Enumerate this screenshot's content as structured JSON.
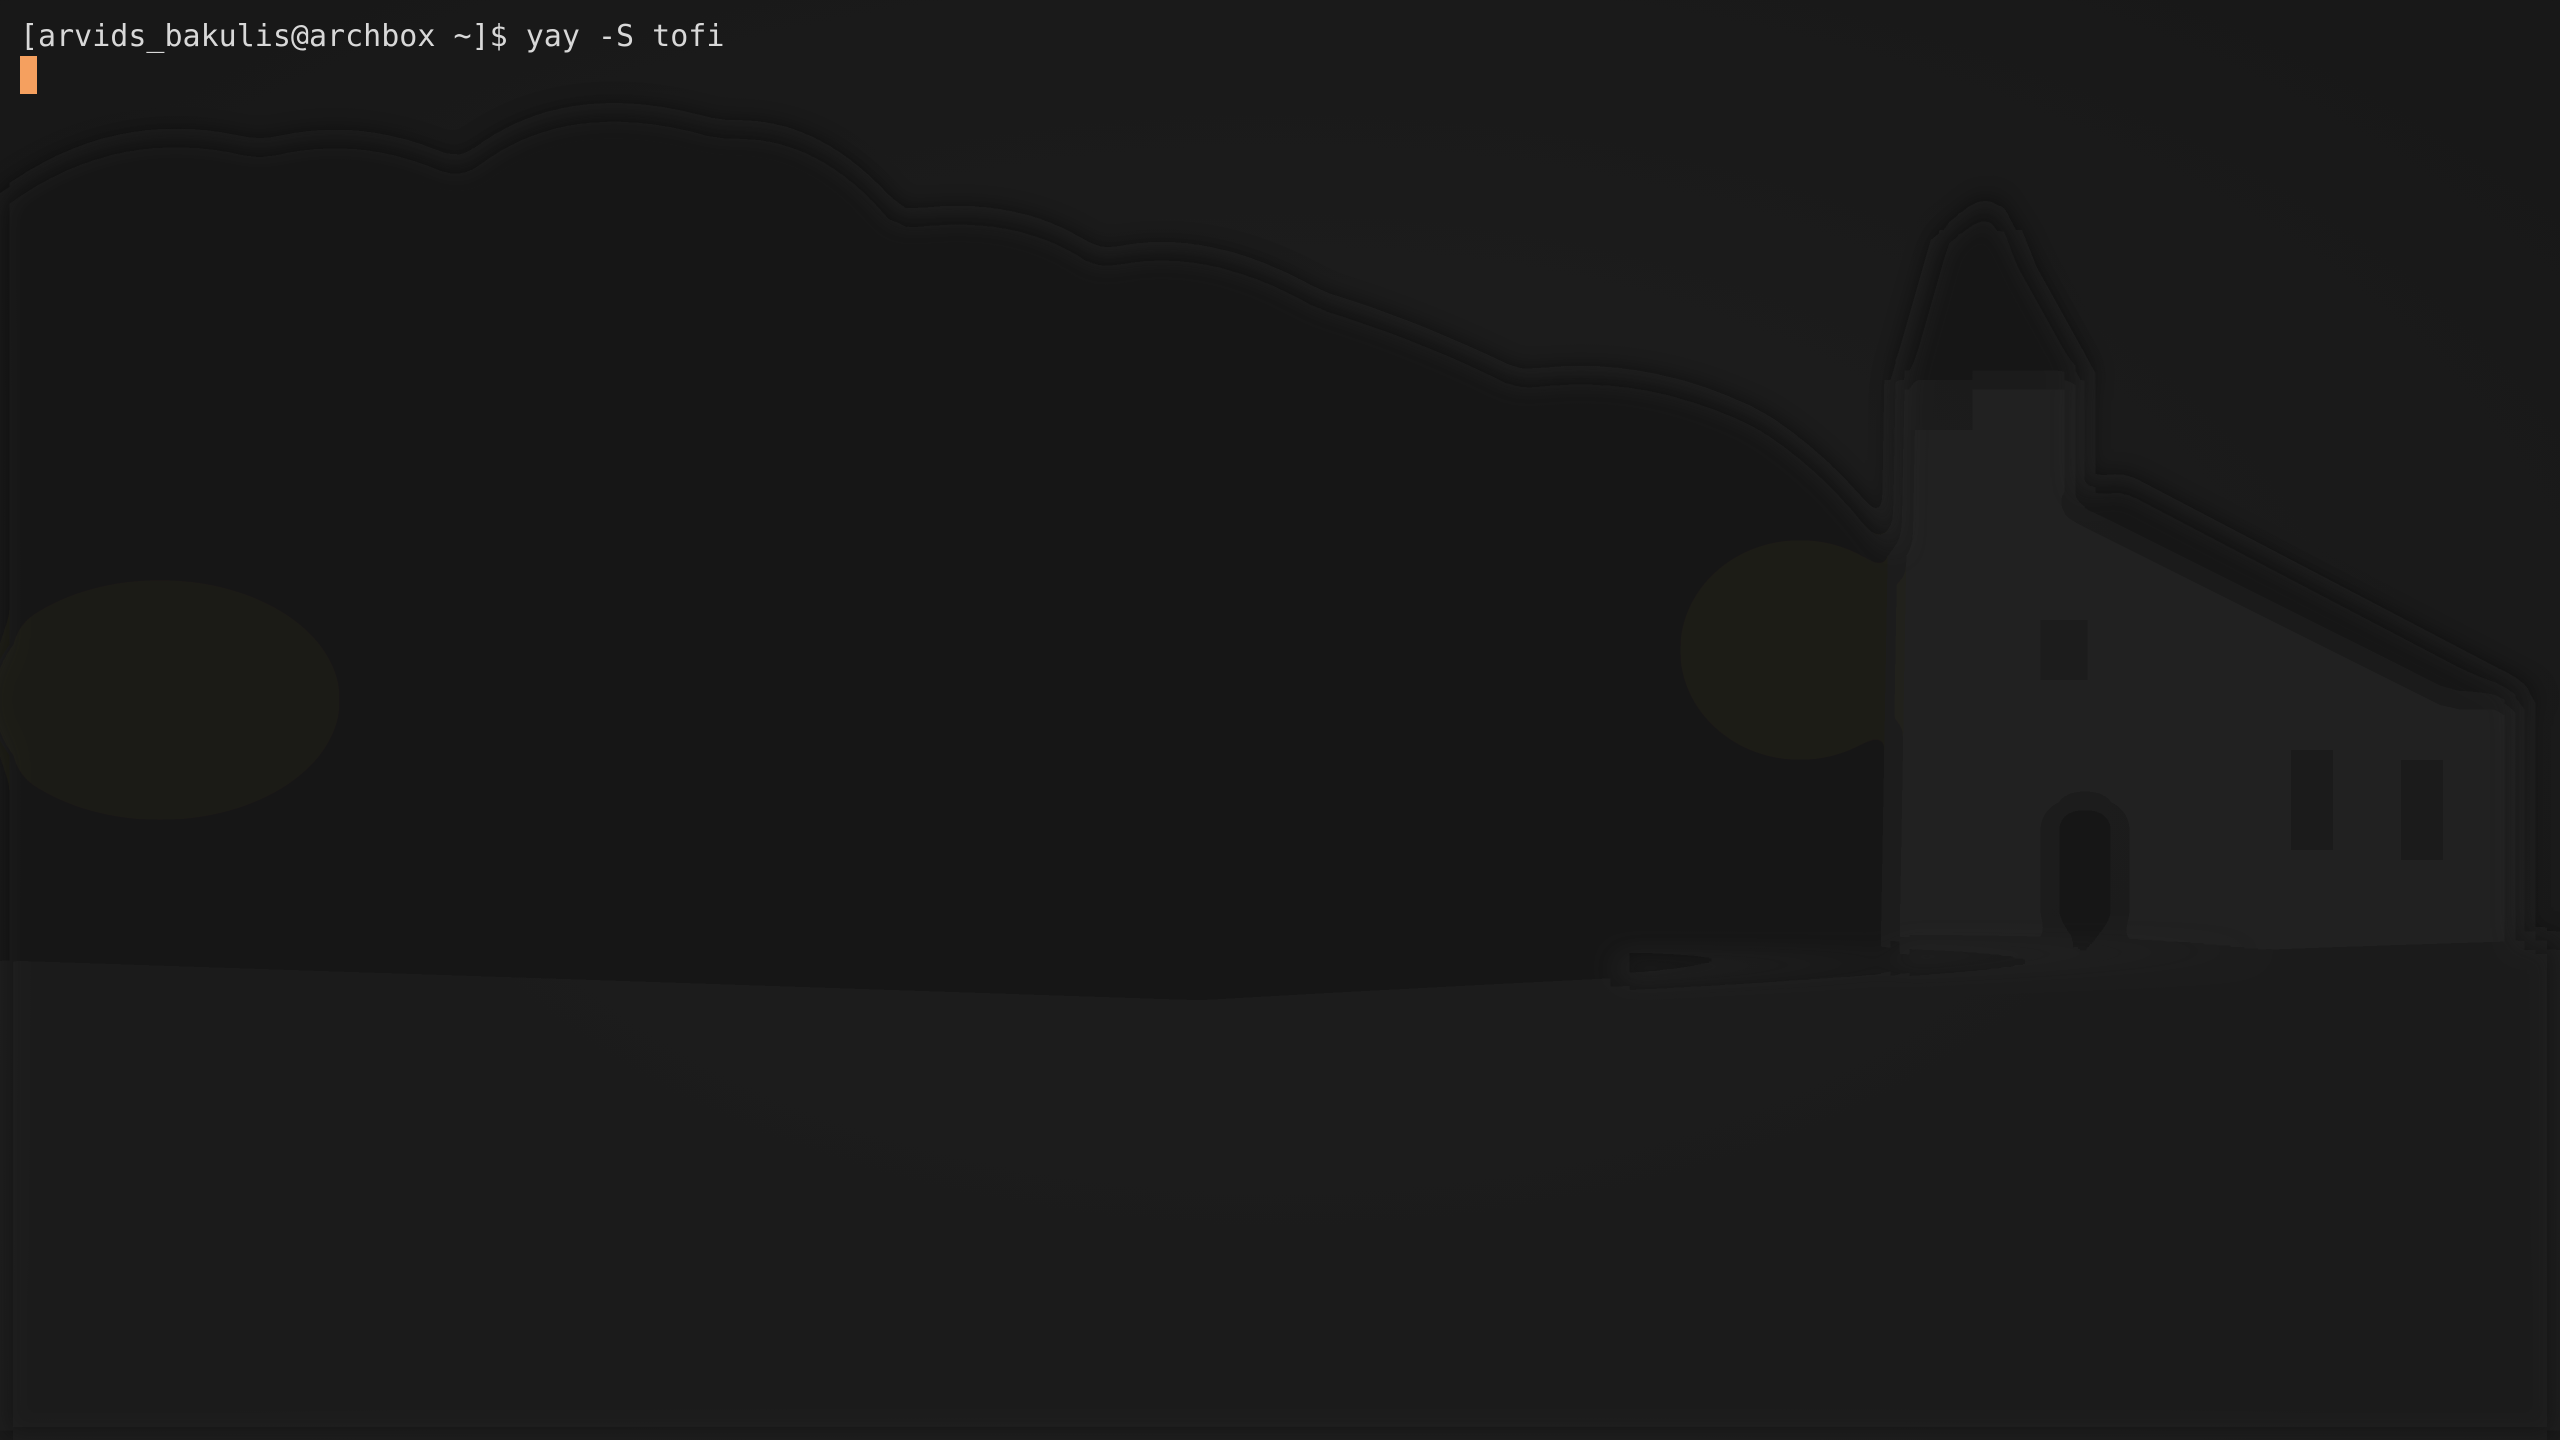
{
  "terminal": {
    "prompt": "[arvids_bakulis@archbox ~]$ ",
    "command": "yay -S tofi"
  },
  "colors": {
    "background": "#1d1d1d",
    "foreground": "#d8d8d8",
    "cursor": "#f5a05f"
  }
}
